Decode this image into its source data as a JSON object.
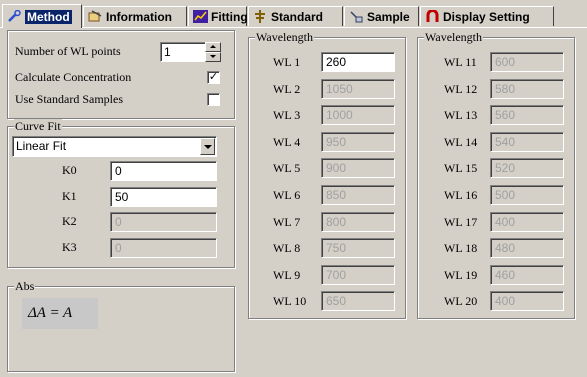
{
  "tabs": [
    {
      "label": "Method",
      "icon": "wrench-icon",
      "active": true
    },
    {
      "label": "Information",
      "icon": "information-icon",
      "active": false
    },
    {
      "label": "Fitting",
      "icon": "chart-icon",
      "active": false
    },
    {
      "label": "Standard",
      "icon": "standard-icon",
      "active": false
    },
    {
      "label": "Sample",
      "icon": "sample-icon",
      "active": false
    },
    {
      "label": "Display Setting",
      "icon": "magnet-icon",
      "active": false
    }
  ],
  "settings": {
    "num_wl_label": "Number of WL points",
    "num_wl_value": "1",
    "calc_conc_label": "Calculate Concentration",
    "calc_conc_checked": true,
    "use_std_label": "Use Standard Samples",
    "use_std_checked": false
  },
  "curve_fit": {
    "legend": "Curve Fit",
    "selected": "Linear Fit",
    "params": [
      {
        "label": "K0",
        "value": "0",
        "enabled": true
      },
      {
        "label": "K1",
        "value": "50",
        "enabled": true
      },
      {
        "label": "K2",
        "value": "0",
        "enabled": false
      },
      {
        "label": "K3",
        "value": "0",
        "enabled": false
      }
    ]
  },
  "abs": {
    "legend": "Abs",
    "formula": "ΔA = A"
  },
  "wavelength_left": {
    "legend": "Wavelength",
    "rows": [
      {
        "label": "WL  1",
        "value": "260",
        "enabled": true
      },
      {
        "label": "WL  2",
        "value": "1050",
        "enabled": false
      },
      {
        "label": "WL  3",
        "value": "1000",
        "enabled": false
      },
      {
        "label": "WL  4",
        "value": "950",
        "enabled": false
      },
      {
        "label": "WL  5",
        "value": "900",
        "enabled": false
      },
      {
        "label": "WL  6",
        "value": "850",
        "enabled": false
      },
      {
        "label": "WL  7",
        "value": "800",
        "enabled": false
      },
      {
        "label": "WL  8",
        "value": "750",
        "enabled": false
      },
      {
        "label": "WL  9",
        "value": "700",
        "enabled": false
      },
      {
        "label": "WL 10",
        "value": "650",
        "enabled": false
      }
    ]
  },
  "wavelength_right": {
    "legend": "Wavelength",
    "rows": [
      {
        "label": "WL 11",
        "value": "600",
        "enabled": false
      },
      {
        "label": "WL 12",
        "value": "580",
        "enabled": false
      },
      {
        "label": "WL 13",
        "value": "560",
        "enabled": false
      },
      {
        "label": "WL 14",
        "value": "540",
        "enabled": false
      },
      {
        "label": "WL 15",
        "value": "520",
        "enabled": false
      },
      {
        "label": "WL 16",
        "value": "500",
        "enabled": false
      },
      {
        "label": "WL 17",
        "value": "400",
        "enabled": false
      },
      {
        "label": "WL 18",
        "value": "480",
        "enabled": false
      },
      {
        "label": "WL 19",
        "value": "460",
        "enabled": false
      },
      {
        "label": "WL 20",
        "value": "400",
        "enabled": false
      }
    ]
  }
}
